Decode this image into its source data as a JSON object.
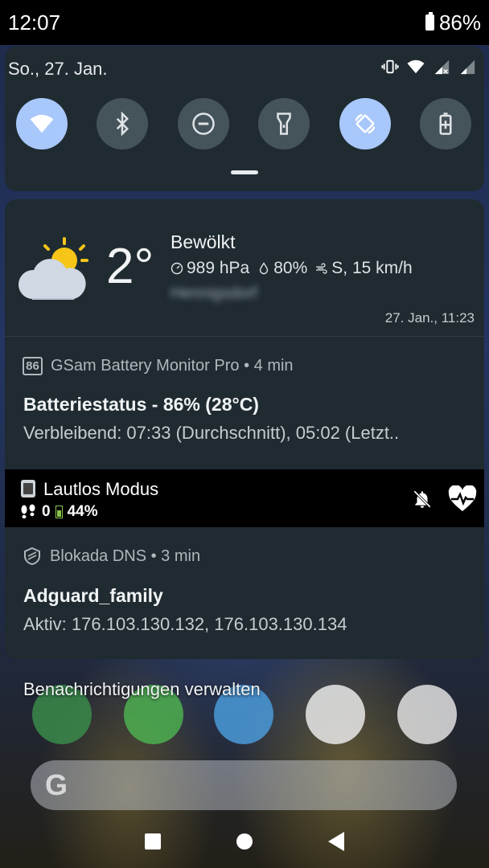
{
  "status_bar": {
    "time": "12:07",
    "battery": "86%"
  },
  "quick_settings": {
    "date": "So., 27. Jan.",
    "tiles": [
      {
        "icon": "wifi-icon",
        "active": true
      },
      {
        "icon": "bluetooth-icon",
        "active": false
      },
      {
        "icon": "do-not-disturb-icon",
        "active": false
      },
      {
        "icon": "flashlight-icon",
        "active": false
      },
      {
        "icon": "auto-rotate-icon",
        "active": true
      },
      {
        "icon": "battery-saver-icon",
        "active": false
      }
    ]
  },
  "weather": {
    "temperature": "2°",
    "condition": "Bewölkt",
    "pressure": "989 hPa",
    "humidity": "80%",
    "wind": "S, 15 km/h",
    "location": "Hennigsdorf",
    "updated": "27. Jan., 11:23"
  },
  "notifications": [
    {
      "app": "GSam Battery Monitor Pro",
      "app_badge": "86",
      "time": "• 4 min",
      "title": "Batteriestatus - 86% (28°C)",
      "text": "Verbleibend: 07:33 (Durchschnitt), 05:02 (Letzt.."
    },
    {
      "app": "Blokada DNS",
      "time": "• 3 min",
      "title": "Adguard_family",
      "text": "Aktiv: 176.103.130.132, 176.103.130.134"
    }
  ],
  "silent_mode": {
    "title": "Lautlos Modus",
    "steps": "0",
    "battery": "44%"
  },
  "manage_label": "Benachrichtigungen verwalten",
  "search": {
    "logo": "G"
  },
  "colors": {
    "accent": "#a8c7fa",
    "panel": "#1f2b31",
    "tile_off": "#45535a"
  }
}
